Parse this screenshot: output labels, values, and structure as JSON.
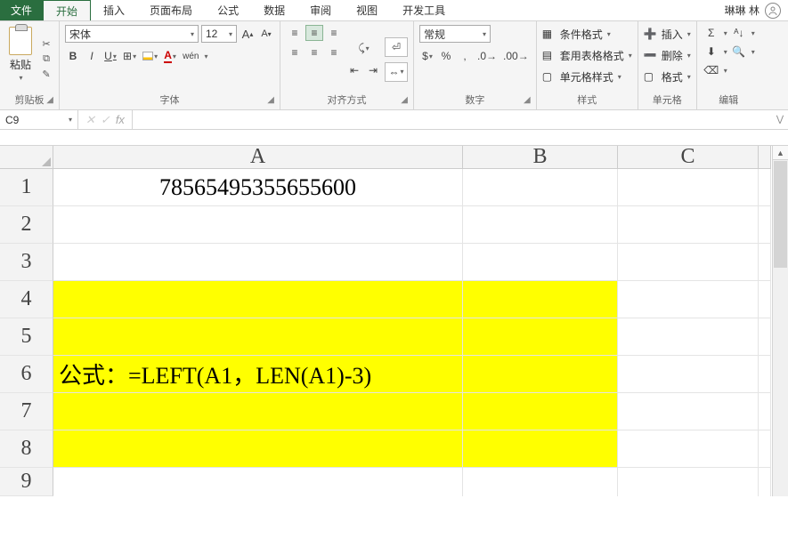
{
  "menu": {
    "file": "文件",
    "tabs": [
      "开始",
      "插入",
      "页面布局",
      "公式",
      "数据",
      "审阅",
      "视图",
      "开发工具"
    ],
    "active": 0,
    "user": "琳琳 林"
  },
  "ribbon": {
    "clipboard": {
      "paste": "粘贴",
      "label": "剪贴板"
    },
    "font": {
      "name": "宋体",
      "size": "12",
      "bold": "B",
      "italic": "I",
      "underline": "U",
      "label": "字体",
      "pinyin": "wén",
      "bigA": "A",
      "smallA": "A"
    },
    "align": {
      "wrap": "",
      "merge": "",
      "label": "对齐方式"
    },
    "number": {
      "fmt": "常规",
      "label": "数字",
      "pct": "%",
      "comma": ","
    },
    "styles": {
      "cond": "条件格式",
      "table": "套用表格格式",
      "cell": "单元格样式",
      "label": "样式"
    },
    "cells": {
      "insert": "插入",
      "delete": "删除",
      "format": "格式",
      "label": "单元格"
    },
    "editing": {
      "sigma": "Σ",
      "label": "编辑"
    }
  },
  "formula_bar": {
    "name": "C9",
    "fx": "fx",
    "value": ""
  },
  "grid": {
    "cols": [
      "A",
      "B",
      "C"
    ],
    "rows": [
      "1",
      "2",
      "3",
      "4",
      "5",
      "6",
      "7",
      "8",
      "9"
    ],
    "cells": {
      "A1": "78565495355655600",
      "A6": "公式：=LEFT(A1，LEN(A1)-3)"
    }
  }
}
